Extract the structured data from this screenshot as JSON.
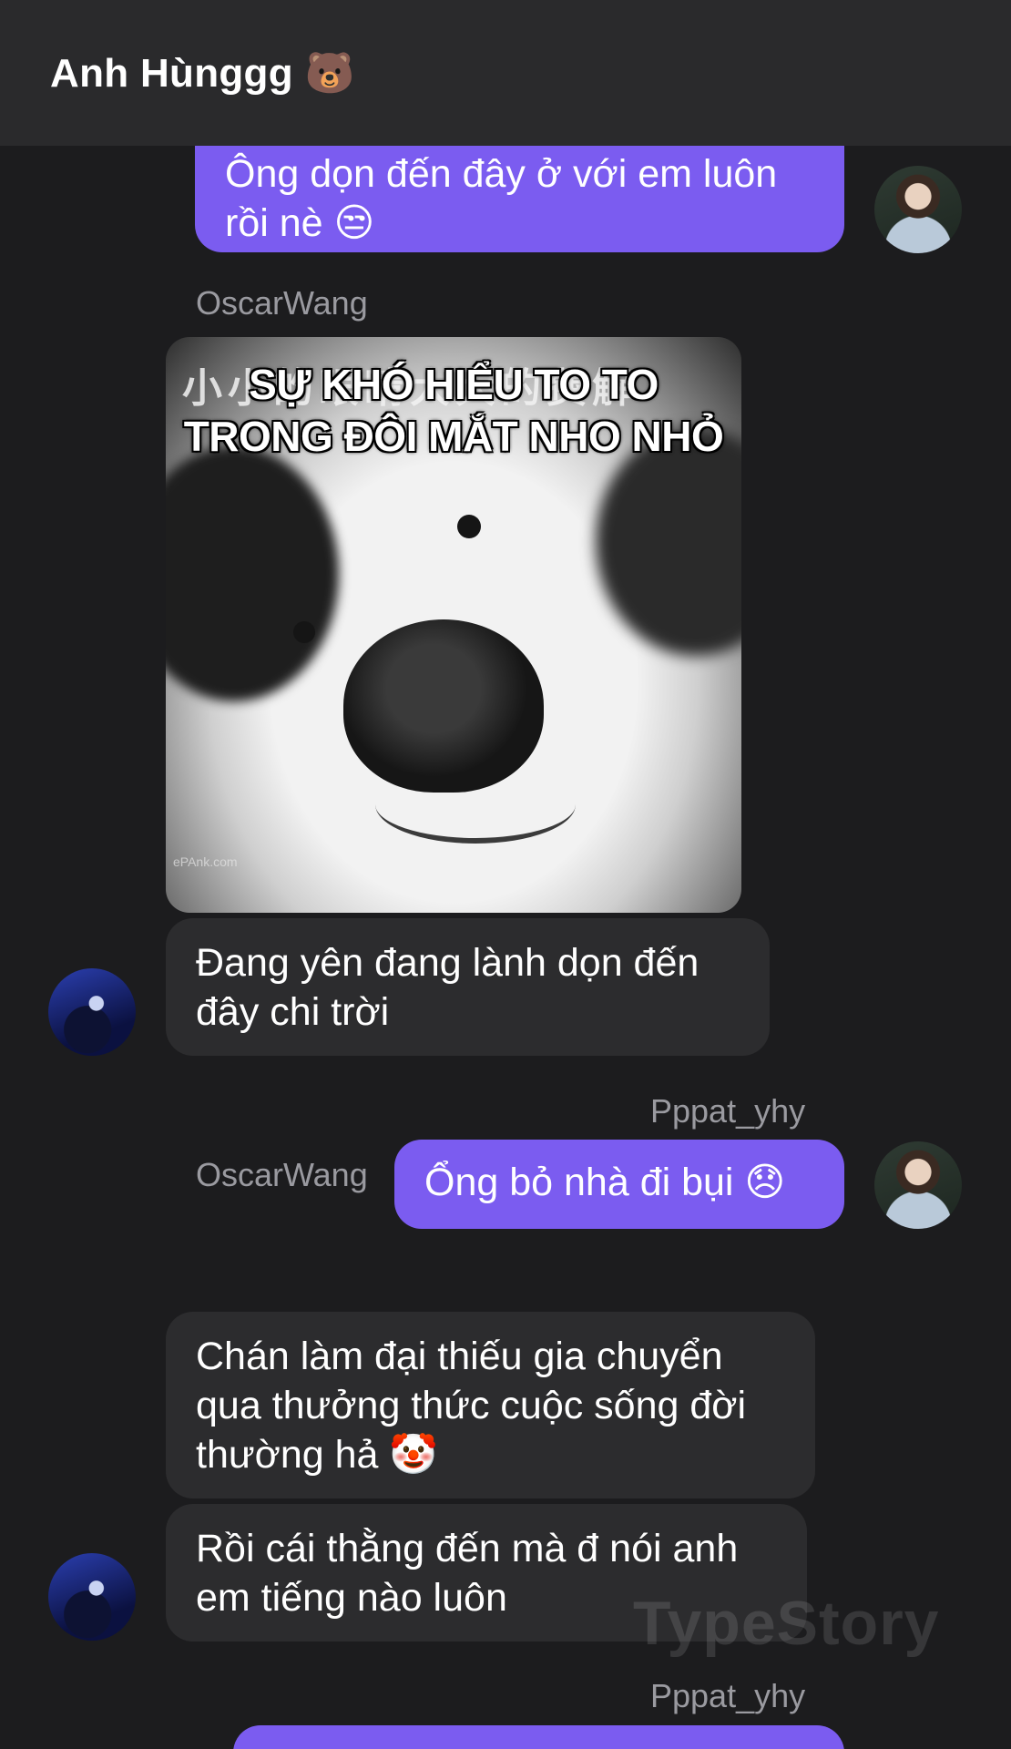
{
  "header": {
    "title": "Anh Hùnggg 🐻"
  },
  "messages": [
    {
      "id": "m1",
      "direction": "out",
      "text": "Ông dọn đến đây ở với em luôn rồi nè 😒"
    },
    {
      "id": "m2",
      "direction": "in",
      "sender": "OscarWang"
    },
    {
      "id": "m3",
      "direction": "in",
      "text": "Đang yên đang lành dọn đến đây chi trời"
    },
    {
      "id": "m4",
      "direction": "out",
      "sender": "Pppat_yhy",
      "text": "Ổng bỏ nhà đi bụi 😞"
    },
    {
      "id": "m5",
      "direction": "in",
      "sender": "OscarWang",
      "text": "Chán làm đại thiếu gia chuyển qua thưởng thức cuộc sống đời thường hả 🤡"
    },
    {
      "id": "m6",
      "direction": "in",
      "text": "Rồi cái thằng đến mà đ nói anh em tiếng nào luôn"
    },
    {
      "id": "m7",
      "direction": "out",
      "sender": "Pppat_yhy"
    }
  ],
  "sticker": {
    "caption_line1": "SỰ KHÓ HIỂU TO TO",
    "caption_line2": "TRONG ĐÔI MẮT NHO NHỎ",
    "background_text": "小小的眼睛大大的费解",
    "watermark_text": "ePAnk.com"
  },
  "watermark": "TypeStory",
  "colors": {
    "background": "#1c1c1e",
    "header": "#2a2a2c",
    "outgoing_bubble": "#7b5cf0",
    "incoming_bubble": "#2c2c2e",
    "sender_name": "#9a9aa0"
  }
}
